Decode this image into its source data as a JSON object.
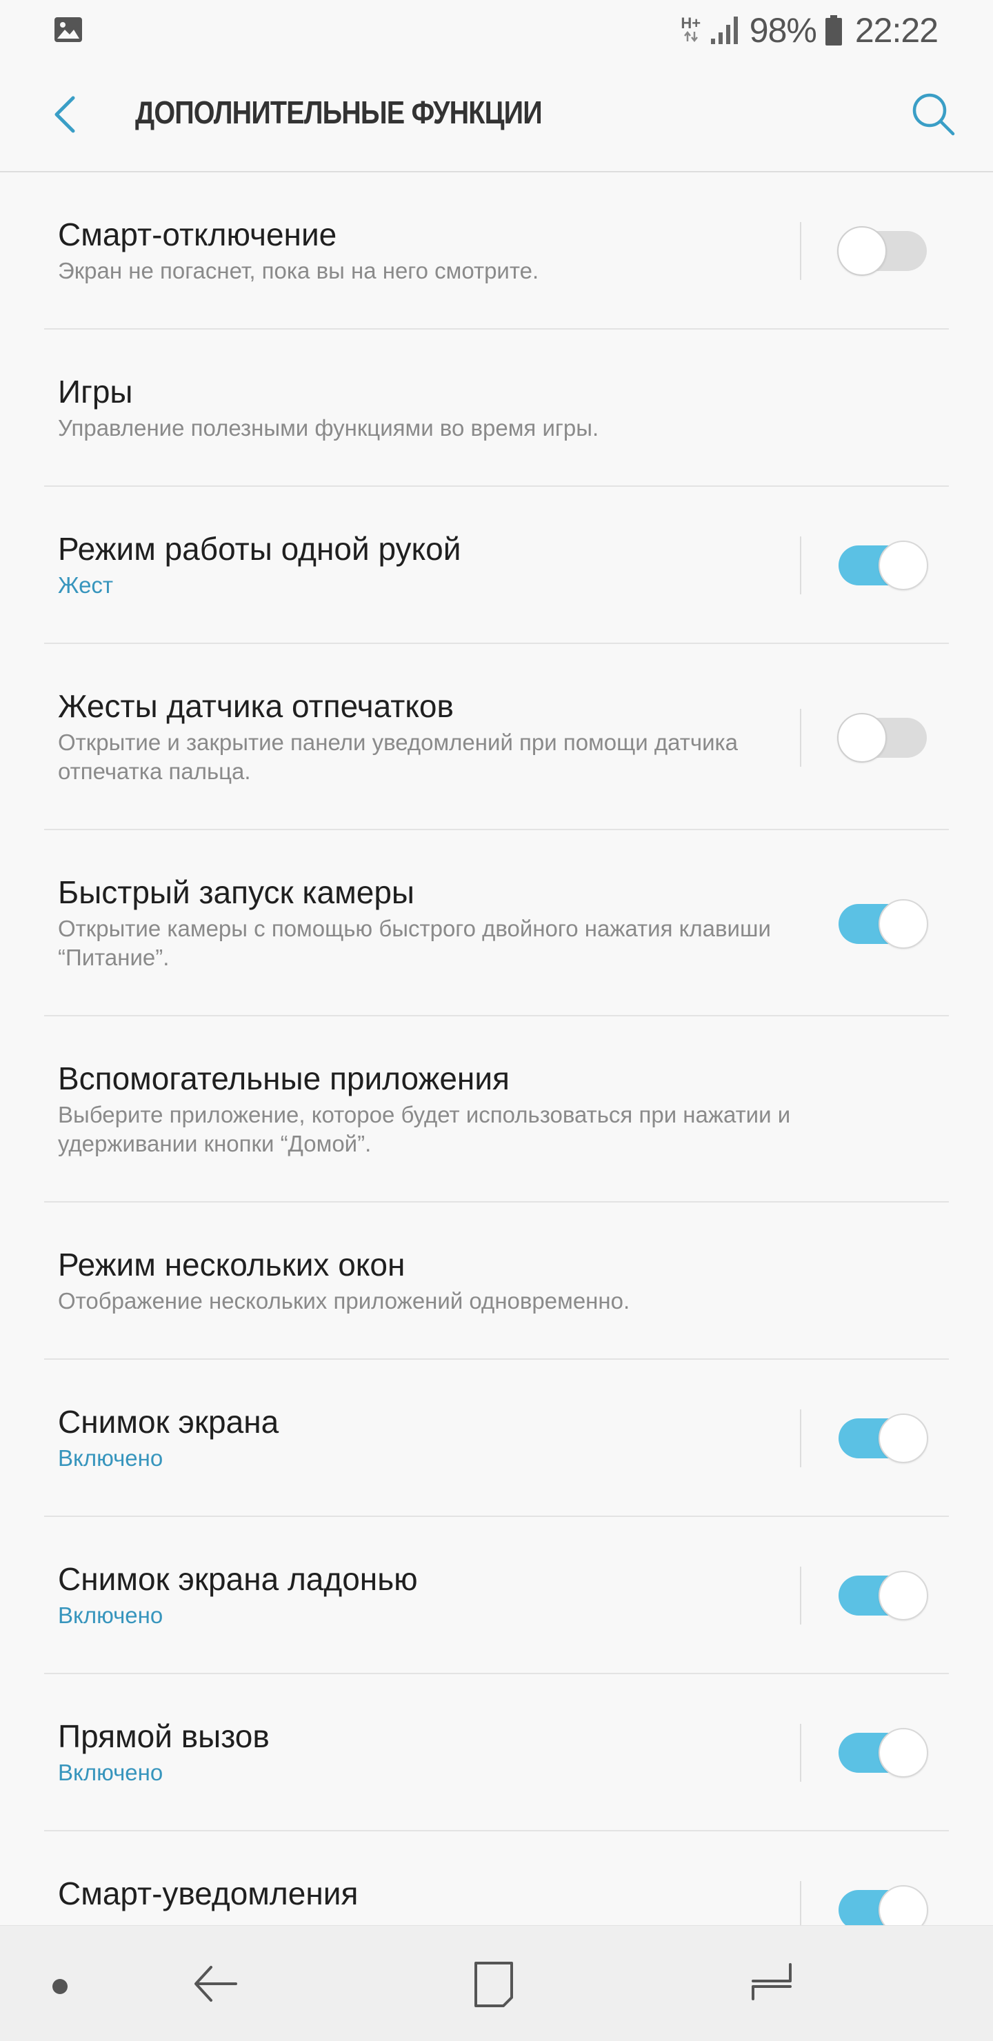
{
  "status_bar": {
    "network": "H+",
    "battery_percent": "98%",
    "time": "22:22"
  },
  "app_bar": {
    "title": "ДОПОЛНИТЕЛЬНЫЕ ФУНКЦИИ"
  },
  "colors": {
    "accent": "#3795bd",
    "toggle_on": "#5bc1e4",
    "toggle_off": "#dcdcdc",
    "background": "#f8f8f8"
  },
  "settings": [
    {
      "title": "Смарт-отключение",
      "subtitle": "Экран не погаснет, пока вы на него смотрите.",
      "toggle": false
    },
    {
      "title": "Игры",
      "subtitle": "Управление полезными функциями во время игры."
    },
    {
      "title": "Режим работы одной рукой",
      "subtitle": "Жест",
      "toggle": true
    },
    {
      "title": "Жесты датчика отпечатков",
      "subtitle": "Открытие и закрытие панели уведомлений при помощи датчика отпечатка пальца.",
      "toggle": false
    },
    {
      "title": "Быстрый запуск камеры",
      "subtitle": "Открытие камеры с помощью быстрого двойного нажатия клавиши “Питание”.",
      "toggle": true
    },
    {
      "title": "Вспомогательные приложения",
      "subtitle": "Выберите приложение, которое будет использоваться при нажатии и удерживании кнопки “Домой”."
    },
    {
      "title": "Режим нескольких окон",
      "subtitle": "Отображение нескольких приложений одновременно."
    },
    {
      "title": "Снимок экрана",
      "subtitle": "Включено",
      "toggle": true
    },
    {
      "title": "Снимок экрана ладонью",
      "subtitle": "Включено",
      "toggle": true
    },
    {
      "title": "Прямой вызов",
      "subtitle": "Включено",
      "toggle": true
    },
    {
      "title": "Смарт-уведомления",
      "subtitle": "",
      "toggle": true
    }
  ],
  "nav_bar": {
    "icons": [
      "dot-icon",
      "back-arrow-icon",
      "home-square-icon",
      "recents-icon"
    ]
  }
}
